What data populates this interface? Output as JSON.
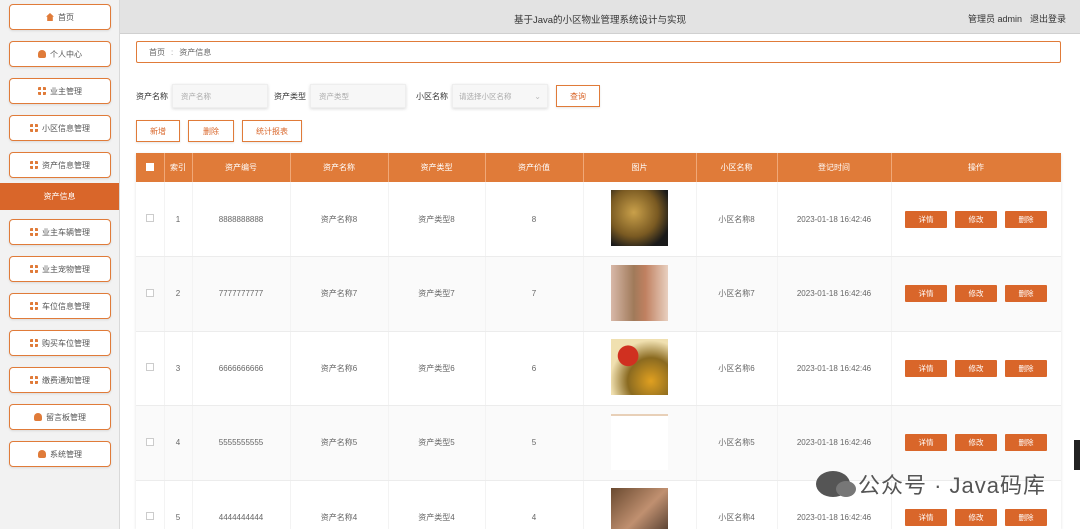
{
  "header": {
    "title": "基于Java的小区物业管理系统设计与实现",
    "user": "管理员 admin",
    "logout": "退出登录"
  },
  "sidebar": {
    "items": [
      {
        "label": "首页",
        "icon": "home-icon"
      },
      {
        "label": "个人中心",
        "icon": "user-icon"
      },
      {
        "label": "业主管理",
        "icon": "grid-icon"
      },
      {
        "label": "小区信息管理",
        "icon": "grid-icon"
      },
      {
        "label": "资产信息管理",
        "icon": "grid-icon"
      },
      {
        "label": "业主车辆管理",
        "icon": "grid-icon"
      },
      {
        "label": "业主宠物管理",
        "icon": "grid-icon"
      },
      {
        "label": "车位信息管理",
        "icon": "grid-icon"
      },
      {
        "label": "购买车位管理",
        "icon": "grid-icon"
      },
      {
        "label": "缴费通知管理",
        "icon": "grid-icon"
      },
      {
        "label": "留言板管理",
        "icon": "user-icon"
      },
      {
        "label": "系统管理",
        "icon": "user-icon"
      }
    ],
    "active_sub": "资产信息"
  },
  "breadcrumb": {
    "home": "首页",
    "current": "资产信息"
  },
  "filters": {
    "name_label": "资产名称",
    "name_placeholder": "资产名称",
    "type_label": "资产类型",
    "type_placeholder": "资产类型",
    "community_label": "小区名称",
    "community_placeholder": "请选择小区名称",
    "search": "查询"
  },
  "actions": {
    "add": "新增",
    "delete": "删除",
    "report": "统计报表"
  },
  "table": {
    "headers": [
      "索引",
      "资产编号",
      "资产名称",
      "资产类型",
      "资产价值",
      "图片",
      "小区名称",
      "登记时间",
      "操作"
    ],
    "row_buttons": {
      "detail": "详情",
      "edit": "修改",
      "delete": "删除"
    },
    "rows": [
      {
        "index": "1",
        "code": "8888888888",
        "name": "资产名称8",
        "type": "资产类型8",
        "value": "8",
        "community": "小区名称8",
        "time": "2023-01-18 16:42:46"
      },
      {
        "index": "2",
        "code": "7777777777",
        "name": "资产名称7",
        "type": "资产类型7",
        "value": "7",
        "community": "小区名称7",
        "time": "2023-01-18 16:42:46"
      },
      {
        "index": "3",
        "code": "6666666666",
        "name": "资产名称6",
        "type": "资产类型6",
        "value": "6",
        "community": "小区名称6",
        "time": "2023-01-18 16:42:46"
      },
      {
        "index": "4",
        "code": "5555555555",
        "name": "资产名称5",
        "type": "资产类型5",
        "value": "5",
        "community": "小区名称5",
        "time": "2023-01-18 16:42:46"
      },
      {
        "index": "5",
        "code": "4444444444",
        "name": "资产名称4",
        "type": "资产类型4",
        "value": "4",
        "community": "小区名称4",
        "time": "2023-01-18 16:42:46"
      }
    ]
  },
  "watermark": "公众号 · Java码库",
  "colors": {
    "accent": "#e07b39",
    "accent_dark": "#d9662a"
  }
}
